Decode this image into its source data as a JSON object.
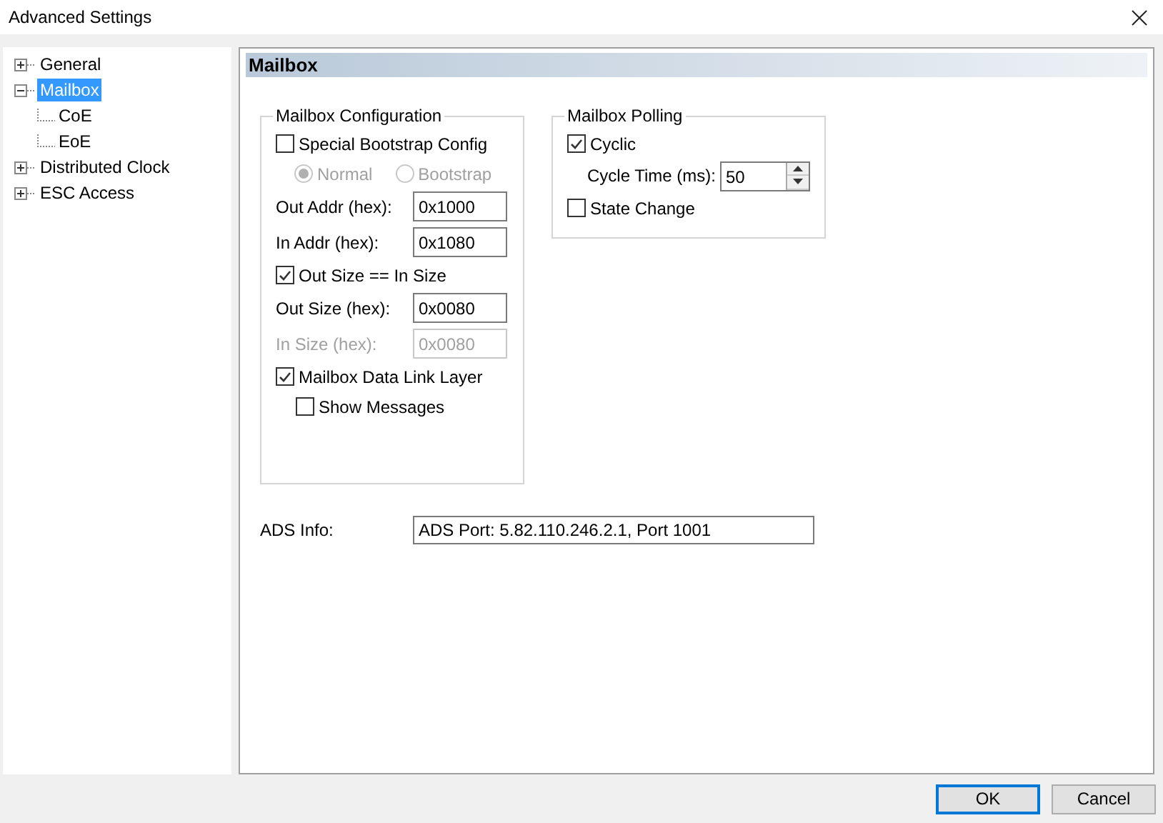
{
  "window": {
    "title": "Advanced Settings"
  },
  "tree": [
    {
      "label": "General",
      "selected": false,
      "expanded": false
    },
    {
      "label": "Mailbox",
      "selected": true,
      "expanded": true,
      "children": [
        {
          "label": "CoE",
          "selected": false
        },
        {
          "label": "EoE",
          "selected": false
        }
      ]
    },
    {
      "label": "Distributed Clock",
      "selected": false,
      "expanded": false
    },
    {
      "label": "ESC Access",
      "selected": false,
      "expanded": false
    }
  ],
  "panel": {
    "title": "Mailbox"
  },
  "configuration": {
    "title": "Mailbox Configuration",
    "items": [
      {
        "kind": "checkbox",
        "label": "Special Bootstrap Config",
        "checked": false
      },
      {
        "kind": "radios",
        "options": [
          {
            "label": "Normal",
            "selected": true,
            "disabled": true
          },
          {
            "label": "Bootstrap",
            "selected": false,
            "disabled": true
          }
        ]
      },
      {
        "kind": "field",
        "label": "Out Addr (hex):",
        "value": "0x1000",
        "disabled": false
      },
      {
        "kind": "field",
        "label": "In Addr (hex):",
        "value": "0x1080",
        "disabled": false
      },
      {
        "kind": "checkbox",
        "label": "Out Size == In Size",
        "checked": true
      },
      {
        "kind": "field",
        "label": "Out Size (hex):",
        "value": "0x0080",
        "disabled": false
      },
      {
        "kind": "field",
        "label": "In Size (hex):",
        "value": "0x0080",
        "disabled": true
      },
      {
        "kind": "checkbox",
        "label": "Mailbox Data Link Layer",
        "checked": true,
        "children": [
          {
            "kind": "checkbox",
            "label": "Show Messages",
            "checked": false
          }
        ]
      }
    ]
  },
  "polling": {
    "title": "Mailbox Polling",
    "items": [
      {
        "kind": "checkbox",
        "label": "Cyclic",
        "checked": true,
        "children": [
          {
            "kind": "spinner",
            "label": "Cycle Time (ms):",
            "value": "50"
          }
        ]
      },
      {
        "kind": "checkbox",
        "label": "State Change",
        "checked": false
      }
    ]
  },
  "ads": {
    "label": "ADS Info:",
    "value": "ADS Port: 5.82.110.246.2.1, Port 1001"
  },
  "buttons": [
    {
      "label": "OK",
      "default": true
    },
    {
      "label": "Cancel",
      "default": false
    }
  ]
}
